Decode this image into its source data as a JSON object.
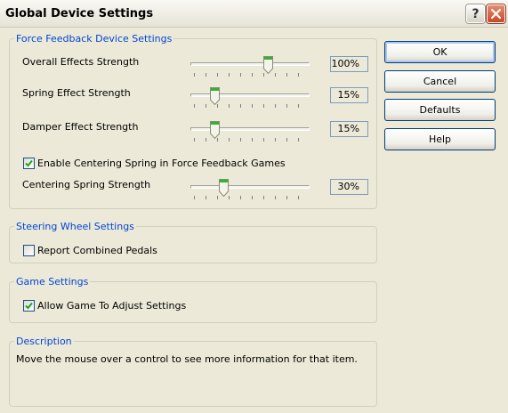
{
  "window": {
    "title": "Global Device Settings"
  },
  "titlebar": {
    "help_glyph": "?",
    "close_icon": "close-icon"
  },
  "force_feedback": {
    "legend": "Force Feedback Device Settings",
    "overall": {
      "label": "Overall Effects Strength",
      "value": "100%",
      "level": 1.0
    },
    "spring": {
      "label": "Spring Effect Strength",
      "value": "15%",
      "level": 0.15
    },
    "damper": {
      "label": "Damper Effect Strength",
      "value": "15%",
      "level": 0.15
    },
    "enable_centering": {
      "label": "Enable Centering Spring in Force Feedback Games",
      "checked": true
    },
    "centering": {
      "label": "Centering Spring Strength",
      "value": "30%",
      "level": 0.3
    }
  },
  "steering": {
    "legend": "Steering Wheel Settings",
    "report_combined": {
      "label": "Report Combined Pedals",
      "checked": false
    }
  },
  "game": {
    "legend": "Game Settings",
    "allow_adjust": {
      "label": "Allow Game To Adjust Settings",
      "checked": true
    }
  },
  "description": {
    "legend": "Description",
    "text": "Move the mouse over a control to see more information for that item."
  },
  "buttons": {
    "ok": "OK",
    "cancel": "Cancel",
    "defaults": "Defaults",
    "help": "Help"
  },
  "colors": {
    "accent": "#0046D5",
    "check": "#21A121",
    "thumb_top": "#2FB52F"
  }
}
